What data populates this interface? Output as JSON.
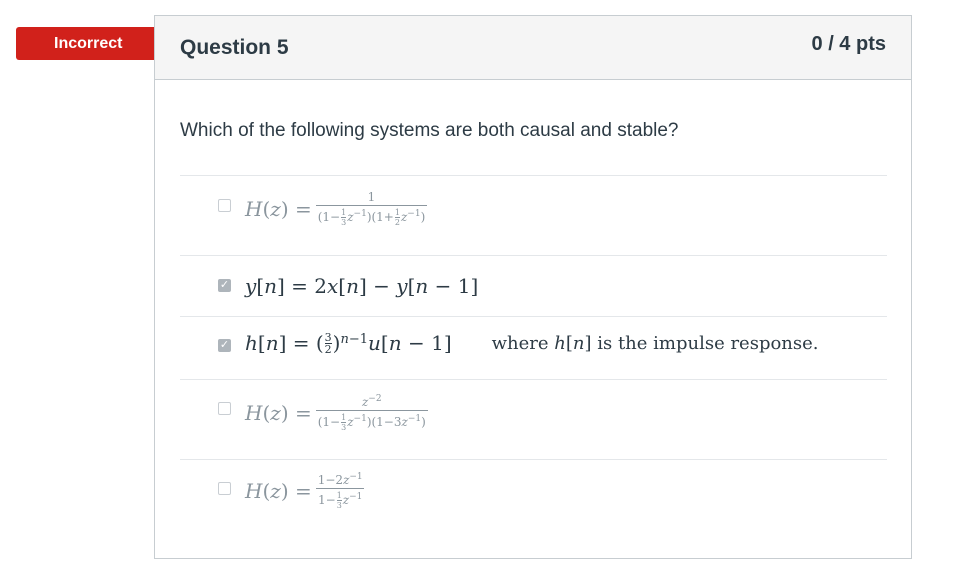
{
  "status_badge": "Incorrect",
  "question": {
    "title": "Question 5",
    "points": "0 / 4 pts",
    "text": "Which of the following systems are both causal and stable?"
  },
  "answers": [
    {
      "latex": "H(z) = 1 / ((1 - (1/3)z^{-1})(1 + (1/2)z^{-1}))",
      "checked": false
    },
    {
      "latex": "y[n] = 2x[n] - y[n-1]",
      "checked": true
    },
    {
      "latex": "h[n] = (3/2)^{n-1} u[n-1]",
      "note": "where h[n] is the impulse response.",
      "checked": true
    },
    {
      "latex": "H(z) = z^{-2} / ((1 - (1/3)z^{-1})(1 - 3z^{-1}))",
      "checked": false
    },
    {
      "latex": "H(z) = (1 - 2z^{-1}) / (1 - (1/3)z^{-1})",
      "checked": false
    }
  ],
  "colors": {
    "badge": "#d1211b",
    "header_bg": "#f5f5f5",
    "checked_box": "#aeb5bb"
  }
}
